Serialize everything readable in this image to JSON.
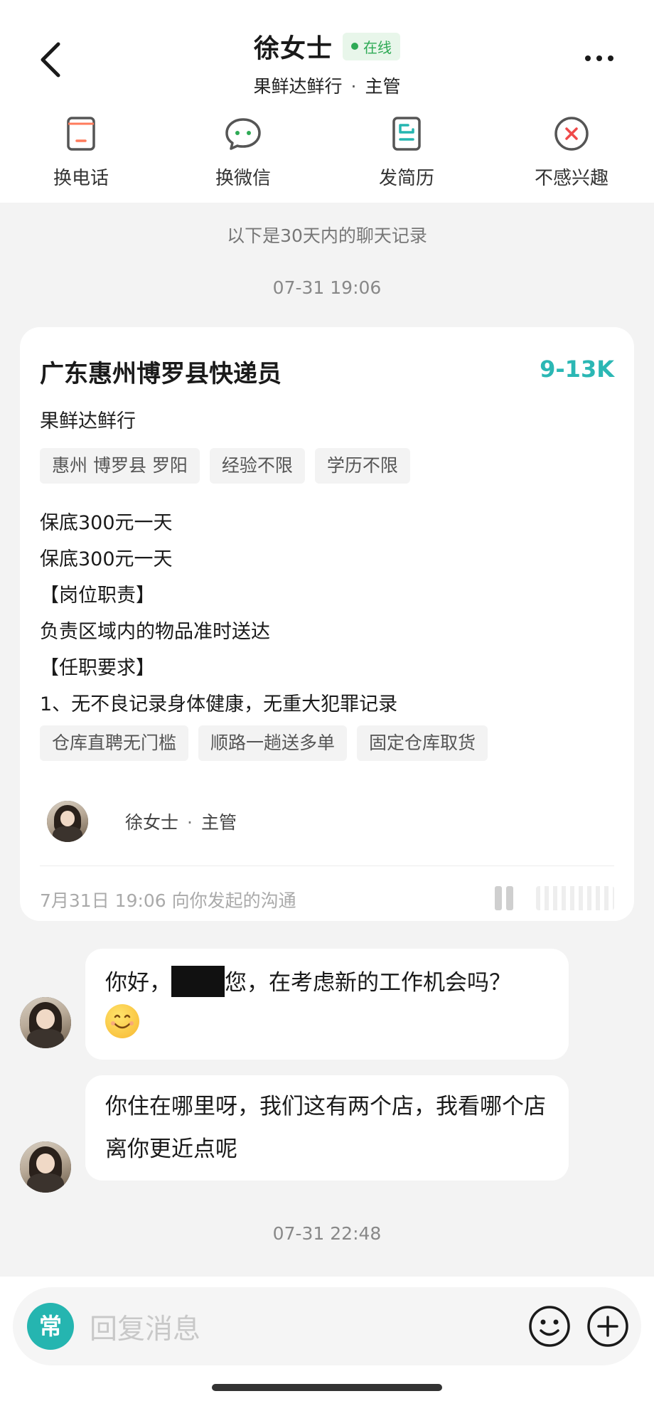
{
  "header": {
    "name": "徐女士",
    "online_label": "在线",
    "company": "果鲜达鲜行",
    "separator": "·",
    "role": "主管"
  },
  "actions": [
    {
      "label": "换电话",
      "icon": "phone-icon"
    },
    {
      "label": "换微信",
      "icon": "wechat-icon"
    },
    {
      "label": "发简历",
      "icon": "resume-icon"
    },
    {
      "label": "不感兴趣",
      "icon": "not-interested-icon"
    }
  ],
  "chat": {
    "notice": "以下是30天内的聊天记录",
    "timestamp_1": "07-31 19:06",
    "timestamp_2": "07-31 22:48"
  },
  "job_card": {
    "title": "广东惠州博罗县快递员",
    "salary": "9-13K",
    "company": "果鲜达鲜行",
    "tags": [
      "惠州 博罗县 罗阳",
      "经验不限",
      "学历不限"
    ],
    "description": [
      "保底300元一天",
      "保底300元一天",
      "【岗位职责】",
      "负责区域内的物品准时送达",
      "【任职要求】",
      "1、无不良记录身体健康，无重大犯罪记录"
    ],
    "benefit_tags": [
      "仓库直聘无门槛",
      "顺路一趟送多单",
      "固定仓库取货"
    ],
    "recruiter_name": "徐女士",
    "recruiter_sep": "·",
    "recruiter_role": "主管",
    "footer": "7月31日 19:06 向你发起的沟通"
  },
  "messages": [
    {
      "prefix": "你好，",
      "suffix": "您，在考虑新的工作机会吗？"
    },
    {
      "text": "你住在哪里呀，我们这有两个店，我看哪个店离你更近点呢"
    }
  ],
  "input": {
    "common_label": "常",
    "placeholder": "回复消息"
  },
  "colors": {
    "accent": "#25b5b0",
    "online": "#2eaa55",
    "salary": "#2bb7b4",
    "background": "#f3f3f3"
  }
}
